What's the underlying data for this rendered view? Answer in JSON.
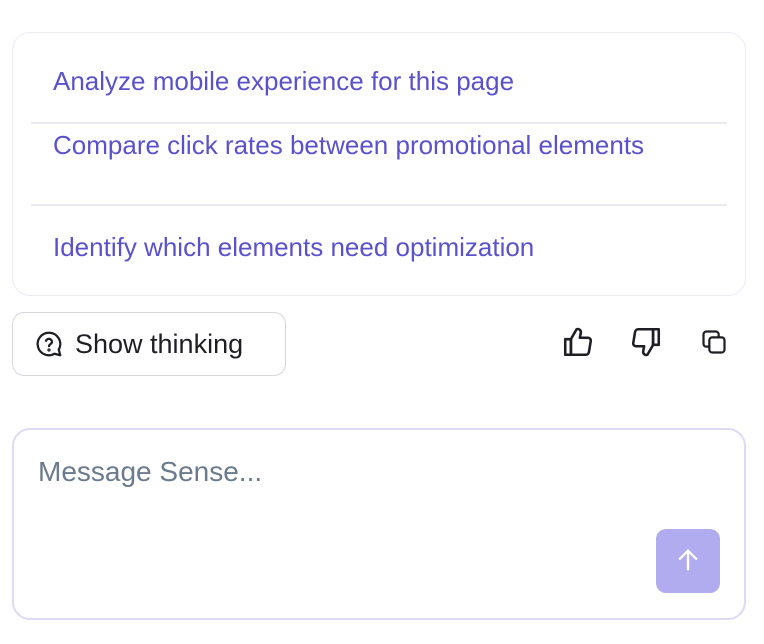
{
  "suggestions": {
    "items": [
      {
        "label": "Analyze mobile experience for this page"
      },
      {
        "label": "Compare click rates between promotional elements"
      },
      {
        "label": "Identify which elements need optimization"
      }
    ]
  },
  "actions": {
    "show_thinking_label": "Show thinking",
    "show_thinking_icon": "chat-question-icon",
    "thumbs_up_icon": "thumbs-up-icon",
    "thumbs_down_icon": "thumbs-down-icon",
    "copy_icon": "copy-icon"
  },
  "composer": {
    "placeholder": "Message Sense...",
    "value": "",
    "send_icon": "arrow-up-icon"
  },
  "colors": {
    "accent_text": "#5a51cc",
    "send_button": "#b1acef",
    "composer_border": "#dcdaf6"
  }
}
